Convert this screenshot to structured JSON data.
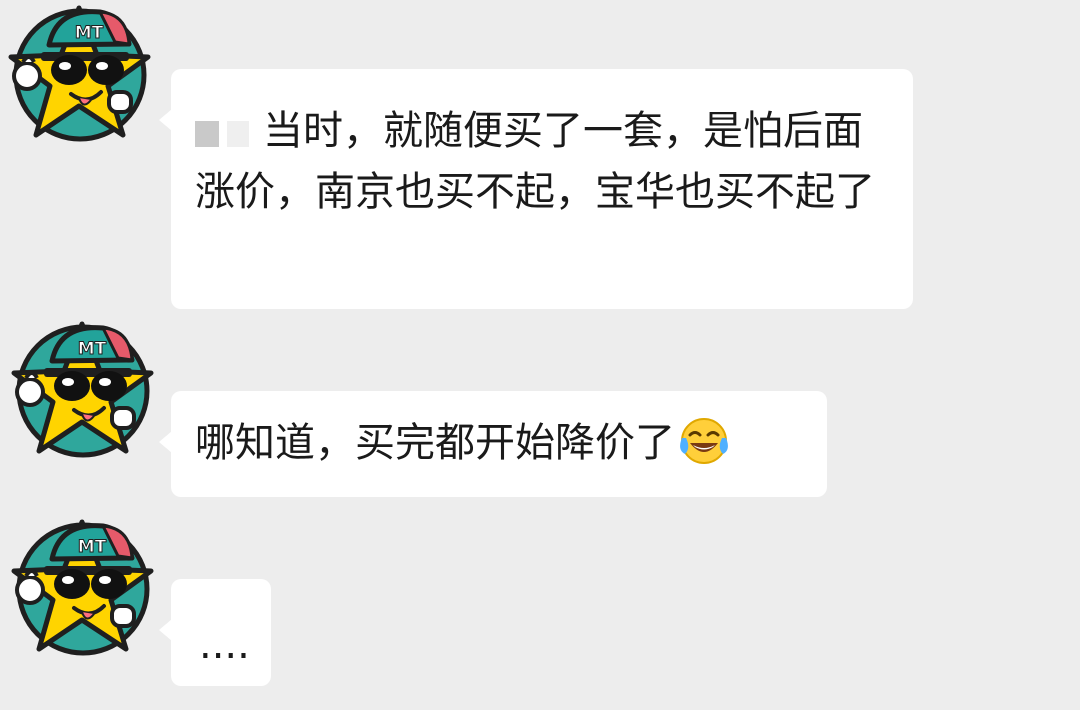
{
  "messages": [
    {
      "avatar_icon": "star-mascot-avatar-icon",
      "text": "当时，就随便买了一套，是怕后面涨价，南京也买不起，宝华也买不起了",
      "redacted_prefix": true
    },
    {
      "avatar_icon": "star-mascot-avatar-icon",
      "text": "哪知道，买完都开始降价了",
      "trailing_emoji": "tears-of-joy-emoji-icon"
    },
    {
      "avatar_icon": "star-mascot-avatar-icon",
      "text": "...."
    }
  ],
  "avatar_cap_text": "MT",
  "colors": {
    "background": "#ededed",
    "bubble": "#ffffff",
    "text": "#1a1a1a",
    "star": "#ffd400",
    "cap": "#22a39a"
  }
}
